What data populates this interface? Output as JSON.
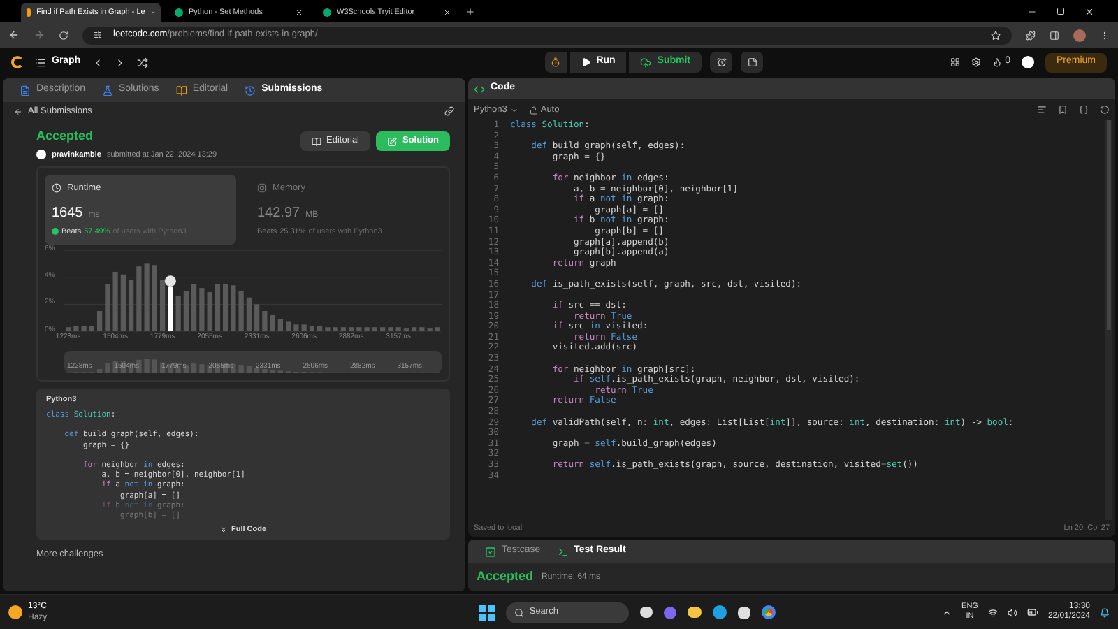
{
  "browser": {
    "tabs": [
      {
        "title": "Find if Path Exists in Graph - Le",
        "selected": true,
        "kind": "leetcode"
      },
      {
        "title": "Python - Set Methods",
        "selected": false,
        "kind": "w3"
      },
      {
        "title": "W3Schools Tryit Editor",
        "selected": false,
        "kind": "w3"
      }
    ],
    "url": "leetcode.com",
    "url_path": "/problems/find-if-path-exists-in-graph/"
  },
  "nav": {
    "problem_list": "Graph",
    "run": "Run",
    "submit": "Submit",
    "streak": "0",
    "premium": "Premium"
  },
  "left": {
    "tabs": [
      {
        "label": "Description",
        "selected": false,
        "kind": "description"
      },
      {
        "label": "Solutions",
        "selected": false,
        "kind": "solutions"
      },
      {
        "label": "Editorial",
        "selected": false,
        "kind": "editorial"
      },
      {
        "label": "Submissions",
        "selected": true,
        "kind": "submissions"
      }
    ],
    "back": "All Submissions",
    "status": "Accepted",
    "user": "pravinkamble",
    "submitted": "submitted at Jan 22, 2024 13:29",
    "editorial_button": "Editorial",
    "solution_button": "Solution",
    "runtime": {
      "title": "Runtime",
      "value": "1645",
      "unit": "ms",
      "beats": "Beats",
      "percent": "57.49%",
      "rest": "of users with Python3",
      "selected": true
    },
    "memory": {
      "title": "Memory",
      "value": "142.97",
      "unit": "MB",
      "beats": "Beats",
      "percent": "25.31%",
      "rest": "of users with Python3",
      "selected": false
    },
    "chart_data": {
      "type": "bar",
      "categories": [
        "1228ms",
        null,
        null,
        null,
        null,
        null,
        "1504ms",
        null,
        null,
        null,
        null,
        null,
        "1779ms",
        null,
        null,
        null,
        null,
        null,
        "2055ms",
        null,
        null,
        null,
        null,
        null,
        "2331ms",
        null,
        null,
        null,
        null,
        null,
        "2606ms",
        null,
        null,
        null,
        null,
        null,
        "2882ms",
        null,
        null,
        null,
        null,
        null,
        "3157ms",
        null,
        null,
        null,
        null,
        null
      ],
      "series": [
        {
          "color": "#5a5a5a",
          "values": [
            0.3,
            0.4,
            0.4,
            0.4,
            1.5,
            3.5,
            4.4,
            4.2,
            3.8,
            4.8,
            5.0,
            4.9,
            3.8,
            null,
            2.6,
            3.0,
            3.5,
            3.2,
            2.9,
            3.5,
            3.5,
            3.4,
            3.0,
            2.5,
            2.0,
            1.5,
            1.2,
            0.9,
            0.7,
            0.5,
            0.5,
            0.4,
            0.4,
            0.3,
            0.3,
            0.3,
            0.3,
            0.3,
            0.3,
            0.3,
            0.3,
            0.3,
            0.3,
            0.2,
            0.3,
            0.3,
            0.2,
            0.3
          ]
        },
        {
          "color": "#ffffff",
          "values": [
            null,
            null,
            null,
            null,
            null,
            null,
            null,
            null,
            null,
            null,
            null,
            null,
            null,
            3.3,
            null,
            null,
            null,
            null,
            null,
            null,
            null,
            null,
            null,
            null,
            null,
            null,
            null,
            null,
            null,
            null,
            null,
            null,
            null,
            null,
            null,
            null,
            null,
            null,
            null,
            null,
            null,
            null,
            null,
            null,
            null,
            null,
            null,
            null
          ]
        }
      ],
      "ylim": [
        0,
        6
      ],
      "yticks": [
        {
          "value": 0,
          "label": "0%"
        },
        {
          "value": 2,
          "label": "2%"
        },
        {
          "value": 4,
          "label": "4%"
        },
        {
          "value": 6,
          "label": "6%"
        }
      ]
    },
    "overview_labels": [
      "1228ms",
      "1504ms",
      "1779ms",
      "2055ms",
      "2331ms",
      "2606ms",
      "2882ms",
      "3157ms"
    ],
    "code_language": "Python3",
    "code_lines": [
      {
        "gap_before": false,
        "t": [
          {
            "text": "class ",
            "kind": "kw"
          },
          {
            "text": "Solution",
            "kind": "cls"
          },
          {
            "text": ":"
          }
        ]
      },
      {
        "gap_before": true,
        "t": [
          {
            "text": "    def ",
            "kind": "kw"
          },
          {
            "text": "build_graph(self, edges):"
          }
        ]
      },
      {
        "gap_before": false,
        "t": [
          {
            "text": "        graph = {}"
          }
        ]
      },
      {
        "gap_before": true,
        "t": [
          {
            "text": "        for",
            "kind": "ctl"
          },
          {
            "text": " neighbor "
          },
          {
            "text": "in",
            "kind": "kw"
          },
          {
            "text": " edges:"
          }
        ]
      },
      {
        "gap_before": false,
        "t": [
          {
            "text": "            a, b = neighbor[0], neighbor[1]"
          }
        ]
      },
      {
        "gap_before": false,
        "t": [
          {
            "text": "            if",
            "kind": "ctl"
          },
          {
            "text": " a "
          },
          {
            "text": "not in",
            "kind": "kw"
          },
          {
            "text": " graph:"
          }
        ]
      },
      {
        "gap_before": false,
        "t": [
          {
            "text": "                graph[a] = []"
          }
        ]
      },
      {
        "gap_before": false,
        "t": [
          {
            "text": "            if",
            "kind": "ctl"
          },
          {
            "text": " b "
          },
          {
            "text": "not in",
            "kind": "kw"
          },
          {
            "text": " graph:"
          }
        ]
      },
      {
        "gap_before": false,
        "t": [
          {
            "text": "                graph[b] = []"
          }
        ]
      }
    ],
    "full_code": "Full Code",
    "more": "More challenges"
  },
  "editor": {
    "title": "Code",
    "language": "Python3",
    "mode": "Auto",
    "saved": "Saved to local",
    "cursor": "Ln 20, Col 27",
    "lines": [
      {
        "n": "1",
        "t": [
          {
            "text": "class ",
            "kind": "kw"
          },
          {
            "text": "Solution",
            "kind": "cls"
          },
          {
            "text": ":"
          }
        ]
      },
      {
        "n": "2"
      },
      {
        "n": "3",
        "t": [
          {
            "text": "    def ",
            "kind": "kw"
          },
          {
            "text": "build_graph(self, edges):"
          }
        ]
      },
      {
        "n": "4",
        "t": [
          {
            "text": "        graph = {}"
          }
        ]
      },
      {
        "n": "5"
      },
      {
        "n": "6",
        "t": [
          {
            "text": "        for",
            "kind": "ctl"
          },
          {
            "text": " neighbor "
          },
          {
            "text": "in",
            "kind": "kw"
          },
          {
            "text": " edges:"
          }
        ]
      },
      {
        "n": "7",
        "t": [
          {
            "text": "            a, b = neighbor[0], neighbor[1]"
          }
        ]
      },
      {
        "n": "8",
        "t": [
          {
            "text": "            if",
            "kind": "ctl"
          },
          {
            "text": " a "
          },
          {
            "text": "not in",
            "kind": "kw"
          },
          {
            "text": " graph:"
          }
        ]
      },
      {
        "n": "9",
        "t": [
          {
            "text": "                graph[a] = []"
          }
        ]
      },
      {
        "n": "10",
        "t": [
          {
            "text": "            if",
            "kind": "ctl"
          },
          {
            "text": " b "
          },
          {
            "text": "not in",
            "kind": "kw"
          },
          {
            "text": " graph:"
          }
        ]
      },
      {
        "n": "11",
        "t": [
          {
            "text": "                graph[b] = []"
          }
        ]
      },
      {
        "n": "12",
        "t": [
          {
            "text": "            graph[a].append(b)"
          }
        ]
      },
      {
        "n": "13",
        "t": [
          {
            "text": "            graph[b].append(a)"
          }
        ]
      },
      {
        "n": "14",
        "t": [
          {
            "text": "        return",
            "kind": "ctl"
          },
          {
            "text": " graph"
          }
        ]
      },
      {
        "n": "15"
      },
      {
        "n": "16",
        "t": [
          {
            "text": "    def ",
            "kind": "kw"
          },
          {
            "text": "is_path_exists(self, graph, src, dst, visited):"
          }
        ]
      },
      {
        "n": "17"
      },
      {
        "n": "18",
        "t": [
          {
            "text": "        if",
            "kind": "ctl"
          },
          {
            "text": " src == dst:"
          }
        ]
      },
      {
        "n": "19",
        "t": [
          {
            "text": "            return ",
            "kind": "ctl"
          },
          {
            "text": "True",
            "kind": "kw"
          }
        ]
      },
      {
        "n": "20",
        "t": [
          {
            "text": "        if",
            "kind": "ctl"
          },
          {
            "text": " src "
          },
          {
            "text": "in",
            "kind": "kw"
          },
          {
            "text": " visited:"
          }
        ]
      },
      {
        "n": "21",
        "t": [
          {
            "text": "            return ",
            "kind": "ctl"
          },
          {
            "text": "False",
            "kind": "kw"
          }
        ]
      },
      {
        "n": "22",
        "t": [
          {
            "text": "        visited.add(src)"
          }
        ]
      },
      {
        "n": "23"
      },
      {
        "n": "24",
        "t": [
          {
            "text": "        for",
            "kind": "ctl"
          },
          {
            "text": " neighbor "
          },
          {
            "text": "in",
            "kind": "kw"
          },
          {
            "text": " graph[src]:"
          }
        ]
      },
      {
        "n": "25",
        "t": [
          {
            "text": "            if ",
            "kind": "ctl"
          },
          {
            "text": "self",
            "kind": "kw"
          },
          {
            "text": ".is_path_exists(graph, neighbor, dst, visited):"
          }
        ]
      },
      {
        "n": "26",
        "t": [
          {
            "text": "                return ",
            "kind": "ctl"
          },
          {
            "text": "True",
            "kind": "kw"
          }
        ]
      },
      {
        "n": "27",
        "t": [
          {
            "text": "        return ",
            "kind": "ctl"
          },
          {
            "text": "False",
            "kind": "kw"
          }
        ]
      },
      {
        "n": "28"
      },
      {
        "n": "29",
        "t": [
          {
            "text": "    def ",
            "kind": "kw"
          },
          {
            "text": "validPath(self, n: "
          },
          {
            "text": "int",
            "kind": "cls"
          },
          {
            "text": ", edges: List[List["
          },
          {
            "text": "int",
            "kind": "cls"
          },
          {
            "text": "]], source: "
          },
          {
            "text": "int",
            "kind": "cls"
          },
          {
            "text": ", destination: "
          },
          {
            "text": "int",
            "kind": "cls"
          },
          {
            "text": ") -> "
          },
          {
            "text": "bool",
            "kind": "cls"
          },
          {
            "text": ":"
          }
        ]
      },
      {
        "n": "30"
      },
      {
        "n": "31",
        "t": [
          {
            "text": "        graph = "
          },
          {
            "text": "self",
            "kind": "kw"
          },
          {
            "text": ".build_graph(edges)"
          }
        ]
      },
      {
        "n": "32"
      },
      {
        "n": "33",
        "t": [
          {
            "text": "        return ",
            "kind": "ctl"
          },
          {
            "text": "self",
            "kind": "kw"
          },
          {
            "text": ".is_path_exists(graph, source, destination, visited="
          },
          {
            "text": "set",
            "kind": "cls"
          },
          {
            "text": "())"
          }
        ]
      },
      {
        "n": "34"
      }
    ]
  },
  "result": {
    "tabs": [
      {
        "label": "Testcase",
        "selected": false,
        "kind": "testcase"
      },
      {
        "label": "Test Result",
        "selected": true,
        "kind": "result"
      }
    ],
    "status": "Accepted",
    "runtime": "Runtime: 64 ms"
  },
  "taskbar": {
    "temperature": "13°C",
    "weather": "Hazy",
    "search": "Search",
    "lang": "ENG",
    "region": "IN",
    "time": "13:30",
    "date": "22/01/2024"
  }
}
